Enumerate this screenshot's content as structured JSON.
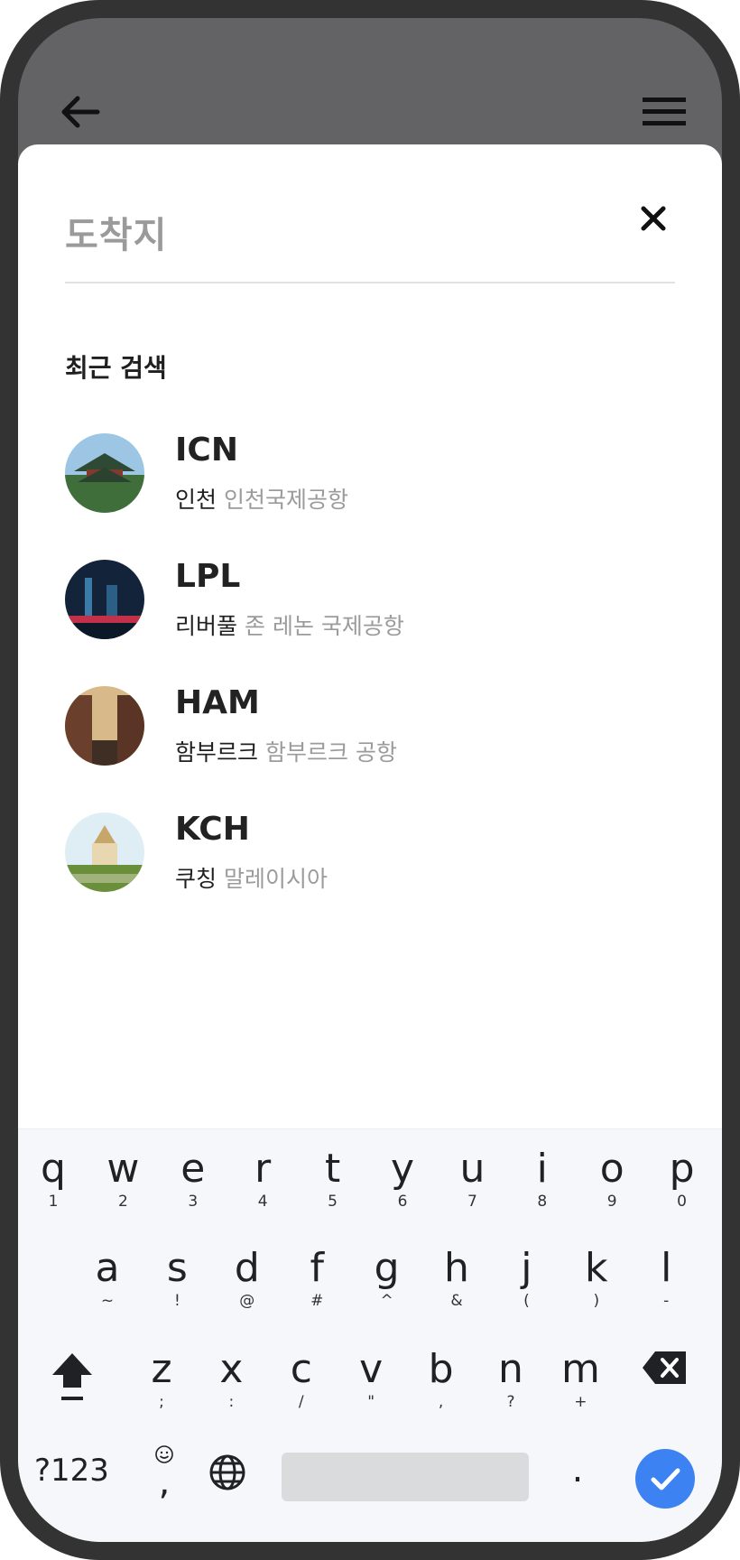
{
  "sheet": {
    "title": "도착지",
    "recent_label": "최근 검색"
  },
  "recent_searches": [
    {
      "code": "ICN",
      "city": "인천",
      "airport": "인천국제공항",
      "thumb_colors": [
        "#8ab7d8",
        "#3f6e3b"
      ]
    },
    {
      "code": "LPL",
      "city": "리버풀",
      "airport": "존 레논 국제공항",
      "thumb_colors": [
        "#12233a",
        "#3c7aa8"
      ]
    },
    {
      "code": "HAM",
      "city": "함부르크",
      "airport": "함부르크 공항",
      "thumb_colors": [
        "#5a3a2a",
        "#d8b98a"
      ]
    },
    {
      "code": "KCH",
      "city": "쿠칭",
      "airport": "말레이시아",
      "thumb_colors": [
        "#cfe3ee",
        "#6a8f3a"
      ]
    }
  ],
  "keyboard": {
    "row1": [
      {
        "k": "q",
        "h": "1"
      },
      {
        "k": "w",
        "h": "2"
      },
      {
        "k": "e",
        "h": "3"
      },
      {
        "k": "r",
        "h": "4"
      },
      {
        "k": "t",
        "h": "5"
      },
      {
        "k": "y",
        "h": "6"
      },
      {
        "k": "u",
        "h": "7"
      },
      {
        "k": "i",
        "h": "8"
      },
      {
        "k": "o",
        "h": "9"
      },
      {
        "k": "p",
        "h": "0"
      }
    ],
    "row2": [
      {
        "k": "a",
        "h": "~"
      },
      {
        "k": "s",
        "h": "!"
      },
      {
        "k": "d",
        "h": "@"
      },
      {
        "k": "f",
        "h": "#"
      },
      {
        "k": "g",
        "h": "^"
      },
      {
        "k": "h",
        "h": "&"
      },
      {
        "k": "j",
        "h": "("
      },
      {
        "k": "k",
        "h": ")"
      },
      {
        "k": "l",
        "h": "-"
      }
    ],
    "row3": [
      {
        "k": "z",
        "h": ";"
      },
      {
        "k": "x",
        "h": ":"
      },
      {
        "k": "c",
        "h": "/"
      },
      {
        "k": "v",
        "h": "\""
      },
      {
        "k": "b",
        "h": ","
      },
      {
        "k": "n",
        "h": "?"
      },
      {
        "k": "m",
        "h": "+"
      }
    ],
    "symbols_label": "?123",
    "comma_label": ",",
    "period_label": ".",
    "enter_color": "#3d82f2"
  },
  "colors": {
    "overlay": "#636365",
    "frame": "#333333"
  }
}
